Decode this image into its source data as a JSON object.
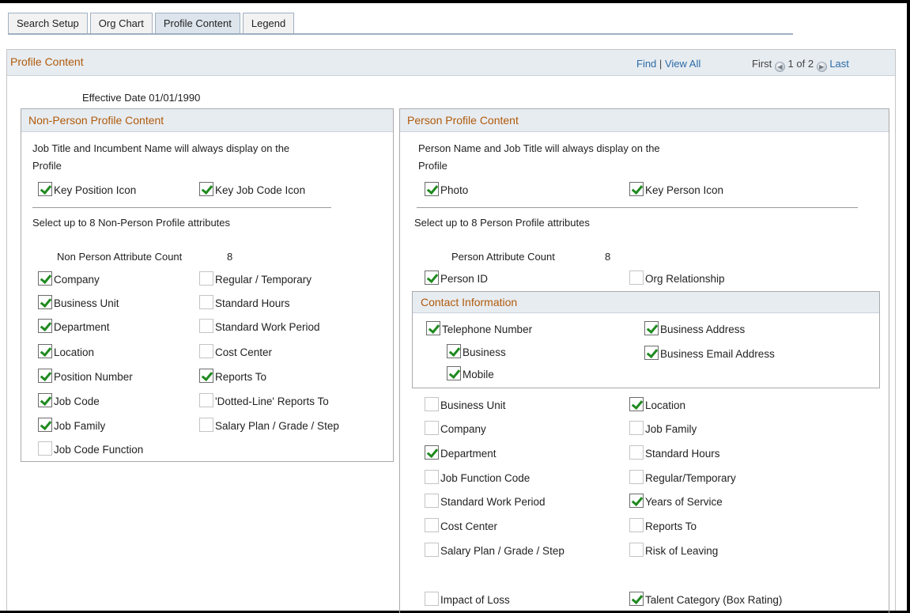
{
  "tabs": [
    "Search Setup",
    "Org Chart",
    "Profile Content",
    "Legend"
  ],
  "header": {
    "title": "Profile Content",
    "find": "Find",
    "sep": "|",
    "view_all": "View All",
    "first": "First",
    "page_info": "1 of 2",
    "last": "Last"
  },
  "effective_date": "Effective Date 01/01/1990",
  "non_person": {
    "title": "Non-Person Profile Content",
    "info_line1": "Job Title and Incumbent Name will always display on the",
    "info_line2": "Profile",
    "key_position_icon": {
      "label": "Key Position Icon",
      "checked": true
    },
    "key_job_code_icon": {
      "label": "Key Job Code Icon",
      "checked": true
    },
    "select_text": "Select up to 8 Non-Person Profile attributes",
    "count_label": "Non Person Attribute Count",
    "count_value": "8",
    "attributes": [
      {
        "label": "Company",
        "checked": true
      },
      {
        "label": "Regular / Temporary",
        "checked": false
      },
      {
        "label": "Business Unit",
        "checked": true
      },
      {
        "label": "Standard Hours",
        "checked": false
      },
      {
        "label": "Department",
        "checked": true
      },
      {
        "label": "Standard Work Period",
        "checked": false
      },
      {
        "label": "Location",
        "checked": true
      },
      {
        "label": "Cost Center",
        "checked": false
      },
      {
        "label": "Position Number",
        "checked": true
      },
      {
        "label": "Reports To",
        "checked": true
      },
      {
        "label": "Job Code",
        "checked": true
      },
      {
        "label": "'Dotted-Line' Reports To",
        "checked": false
      },
      {
        "label": "Job Family",
        "checked": true
      },
      {
        "label": "Salary Plan / Grade / Step",
        "checked": false
      },
      {
        "label": "Job Code Function",
        "checked": false
      }
    ]
  },
  "person": {
    "title": "Person Profile Content",
    "info_line1": "Person Name and Job Title will always display on the",
    "info_line2": "Profile",
    "photo": {
      "label": "Photo",
      "checked": true
    },
    "key_person_icon": {
      "label": "Key Person Icon",
      "checked": true
    },
    "select_text": "Select up to 8 Person Profile attributes",
    "count_label": "Person Attribute Count",
    "count_value": "8",
    "person_id": {
      "label": "Person ID",
      "checked": true
    },
    "org_relationship": {
      "label": "Org Relationship",
      "checked": false
    },
    "contact": {
      "title": "Contact Information",
      "telephone_number": {
        "label": "Telephone Number",
        "checked": true
      },
      "business": {
        "label": "Business",
        "checked": true
      },
      "mobile": {
        "label": "Mobile",
        "checked": true
      },
      "business_address": {
        "label": "Business Address",
        "checked": true
      },
      "business_email": {
        "label": "Business Email Address",
        "checked": true
      }
    },
    "attributes": [
      {
        "label": "Business Unit",
        "checked": false
      },
      {
        "label": "Location",
        "checked": true
      },
      {
        "label": "Company",
        "checked": false
      },
      {
        "label": "Job Family",
        "checked": false
      },
      {
        "label": "Department",
        "checked": true
      },
      {
        "label": "Standard Hours",
        "checked": false
      },
      {
        "label": "Job Function Code",
        "checked": false
      },
      {
        "label": "Regular/Temporary",
        "checked": false
      },
      {
        "label": "Standard Work Period",
        "checked": false
      },
      {
        "label": "Years of Service",
        "checked": true
      },
      {
        "label": "Cost Center",
        "checked": false
      },
      {
        "label": "Reports To",
        "checked": false
      },
      {
        "label": "Salary Plan / Grade / Step",
        "checked": false
      },
      {
        "label": "Risk of Leaving",
        "checked": false
      },
      {
        "label": "Impact of Loss",
        "checked": false
      },
      {
        "label": "Talent Category (Box Rating)",
        "checked": true
      }
    ]
  }
}
